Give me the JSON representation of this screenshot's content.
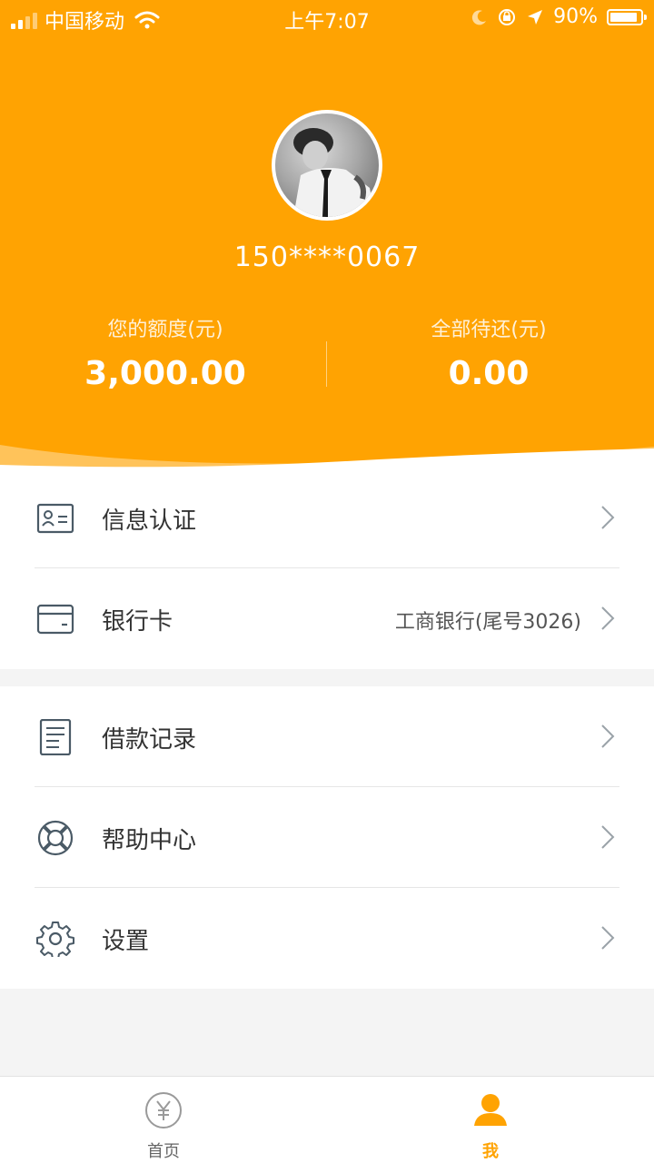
{
  "status_bar": {
    "carrier": "中国移动",
    "time": "上午7:07",
    "battery": "90%",
    "battery_level": 0.9
  },
  "profile": {
    "phone": "150****0067",
    "limit_label": "您的额度(元)",
    "limit_value": "3,000.00",
    "due_label": "全部待还(元)",
    "due_value": "0.00"
  },
  "menu": {
    "info_auth": "信息认证",
    "bank_card": "银行卡",
    "bank_card_detail": "工商银行(尾号3026)",
    "loan_records": "借款记录",
    "help_center": "帮助中心",
    "settings": "设置"
  },
  "tabs": {
    "home": "首页",
    "me": "我"
  },
  "colors": {
    "accent": "#ffa302",
    "icon": "#4a5a66",
    "inactive_tab": "#9a9a9a"
  },
  "icons": {
    "info_auth": "id-card-icon",
    "bank_card": "bank-card-icon",
    "loan_records": "document-icon",
    "help_center": "lifebuoy-icon",
    "settings": "gear-icon",
    "home": "yen-icon",
    "me": "user-icon"
  }
}
